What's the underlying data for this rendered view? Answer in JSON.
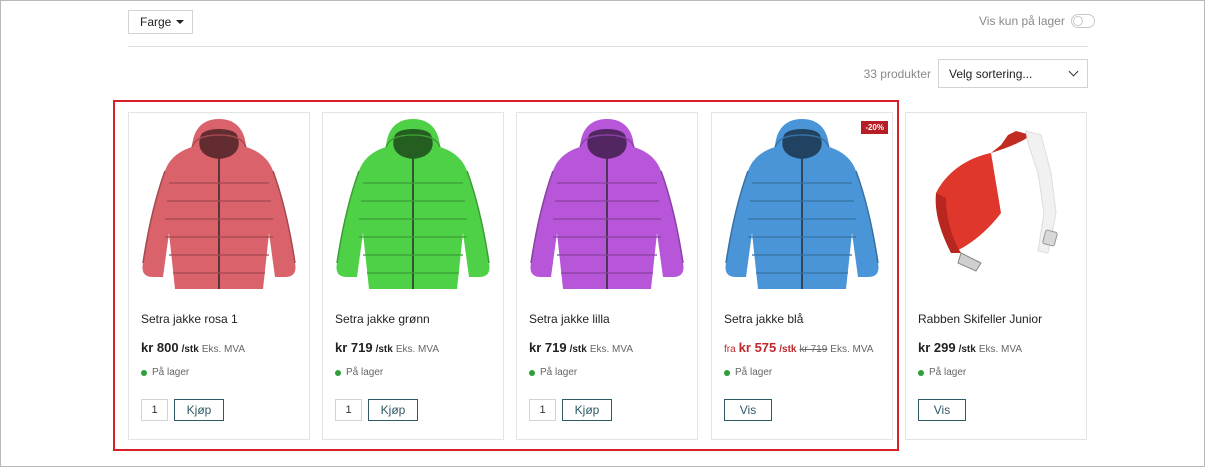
{
  "filters": {
    "color_label": "Farge",
    "in_stock_label": "Vis kun på lager"
  },
  "listing": {
    "count_text": "33 produkter",
    "sort_placeholder": "Velg sortering..."
  },
  "colors": {
    "accent": "#2f5a66",
    "sale": "#c0272d",
    "highlight": "#d61f26",
    "in_stock": "#2e9e3a"
  },
  "products": [
    {
      "name": "Setra jakke rosa 1",
      "price": "kr 800",
      "unit": "/stk",
      "vat": "Eks. MVA",
      "stock": "På lager",
      "qty": "1",
      "action": "Kjøp",
      "color": "#d9626b"
    },
    {
      "name": "Setra jakke grønn",
      "price": "kr 719",
      "unit": "/stk",
      "vat": "Eks. MVA",
      "stock": "På lager",
      "qty": "1",
      "action": "Kjøp",
      "color": "#4fd147"
    },
    {
      "name": "Setra jakke lilla",
      "price": "kr 719",
      "unit": "/stk",
      "vat": "Eks. MVA",
      "stock": "På lager",
      "qty": "1",
      "action": "Kjøp",
      "color": "#b756d8"
    },
    {
      "name": "Setra jakke blå",
      "from": "fra",
      "price": "kr 575",
      "unit": "/stk",
      "old_price": "kr 719",
      "vat": "Eks. MVA",
      "stock": "På lager",
      "action": "Vis",
      "badge": "-20%",
      "color": "#4a95d8"
    },
    {
      "name": "Rabben Skifeller Junior",
      "price": "kr 299",
      "unit": "/stk",
      "vat": "Eks. MVA",
      "stock": "På lager",
      "action": "Vis",
      "color": "#e0372d"
    }
  ]
}
